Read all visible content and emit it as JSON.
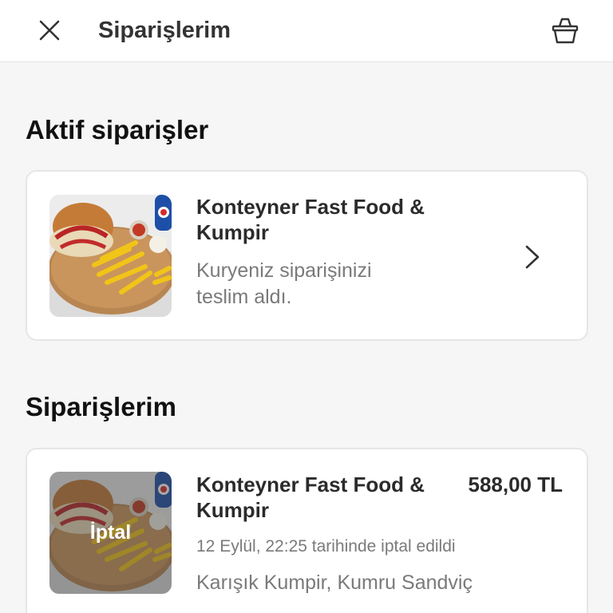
{
  "header": {
    "title": "Siparişlerim",
    "close_icon": "close-icon",
    "basket_icon": "basket-icon"
  },
  "active_section": {
    "title": "Aktif siparişler",
    "order": {
      "shop_name": "Konteyner Fast Food & Kumpir",
      "status": "Kuryeniz siparişinizi teslim aldı.",
      "image": "burger-fries-plate"
    }
  },
  "orders_section": {
    "title": "Siparişlerim",
    "orders": [
      {
        "shop_name": "Konteyner Fast Food & Kumpir",
        "price": "588,00 TL",
        "overlay_label": "İptal",
        "date_text": "12 Eylül, 22:25 tarihinde iptal edildi",
        "items": "Karışık Kumpir, Kumru Sandviç",
        "image": "burger-fries-plate"
      }
    ]
  },
  "colors": {
    "background": "#f6f6f6",
    "card": "#ffffff",
    "text_primary": "#2b2b2b",
    "text_secondary": "#7a7a7a"
  }
}
